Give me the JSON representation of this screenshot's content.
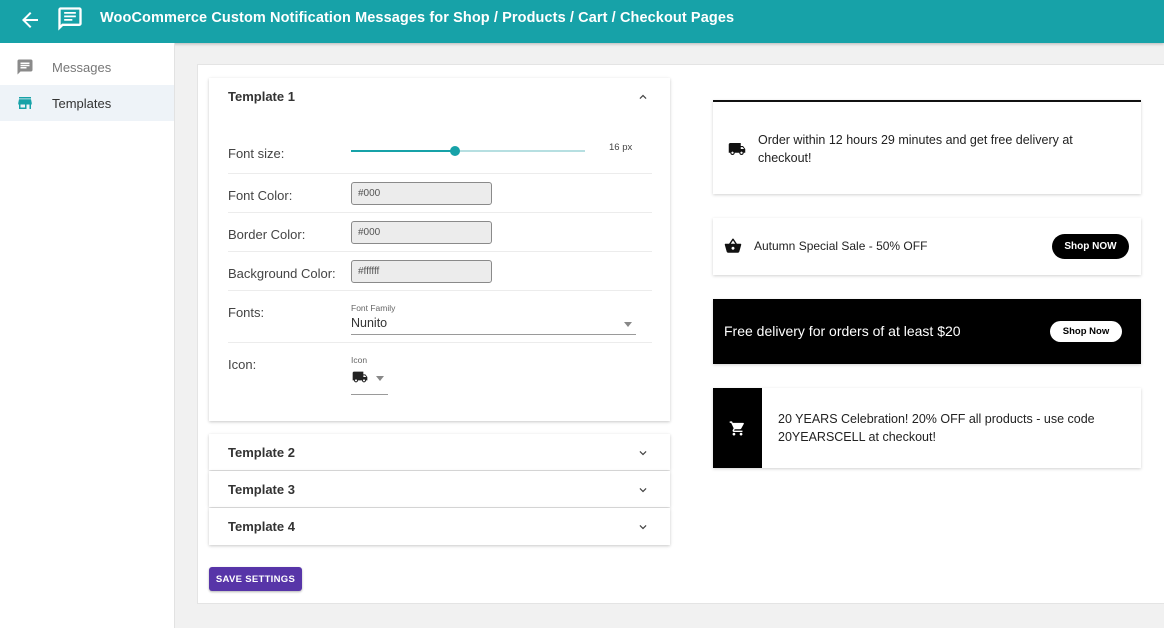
{
  "header": {
    "title": "WooCommerce Custom Notification Messages for Shop / Products / Cart / Checkout Pages",
    "back_icon": "arrow-left-icon",
    "logo_icon": "message-box-icon"
  },
  "sidebar": {
    "items": [
      {
        "label": "Messages",
        "icon": "message-icon",
        "active": false
      },
      {
        "label": "Templates",
        "icon": "store-icon",
        "active": true
      }
    ]
  },
  "template1": {
    "title": "Template 1",
    "font_size": {
      "label": "Font size:",
      "value": 16,
      "min": 0,
      "max": 36,
      "display": "16 px"
    },
    "font_color": {
      "label": "Font Color:",
      "value": "#000"
    },
    "border_color": {
      "label": "Border Color:",
      "value": "#000"
    },
    "background_color": {
      "label": "Background Color:",
      "value": "#ffffff"
    },
    "fonts": {
      "label": "Fonts:",
      "field_label": "Font Family",
      "value": "Nunito"
    },
    "icon": {
      "label": "Icon:",
      "field_label": "Icon",
      "value": "truck-icon"
    }
  },
  "templates_collapsed": [
    {
      "title": "Template 2"
    },
    {
      "title": "Template 3"
    },
    {
      "title": "Template 4"
    }
  ],
  "save_label": "SAVE SETTINGS",
  "previews": [
    {
      "text": "Order within 12 hours 29 minutes and get free delivery at checkout!",
      "icon": "truck-icon"
    },
    {
      "text": "Autumn Special Sale - 50% OFF",
      "icon": "basket-icon",
      "button": "Shop NOW"
    },
    {
      "text": "Free delivery for orders of at least $20",
      "button": "Shop Now"
    },
    {
      "text": "20 YEARS Celebration! 20% OFF all products - use code 20YEARSCELL at checkout!",
      "icon": "cart-icon"
    }
  ],
  "colors": {
    "primary": "#17a2a8",
    "save_button": "#5735a8",
    "black": "#000000"
  }
}
